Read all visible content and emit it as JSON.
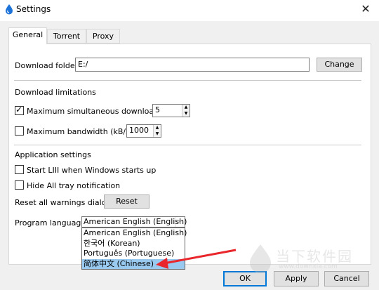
{
  "window": {
    "title": "Settings",
    "close_glyph": "✕",
    "icon": "app-drop-icon"
  },
  "tabs": [
    {
      "label": "General",
      "active": true
    },
    {
      "label": "Torrent",
      "active": false
    },
    {
      "label": "Proxy",
      "active": false
    }
  ],
  "general": {
    "download_folder_label": "Download folder:",
    "download_folder_value": "E:/",
    "change_button": "Change",
    "download_limitations_heading": "Download limitations",
    "max_downloads": {
      "label": "Maximum simultaneous downloads",
      "checked": true,
      "value": "5"
    },
    "max_bandwidth": {
      "label": "Maximum bandwidth (kB/s)",
      "checked": false,
      "value": "1000"
    },
    "app_settings_heading": "Application settings",
    "start_on_boot": {
      "label": "Start LIII when Windows starts up",
      "checked": false
    },
    "hide_tray": {
      "label": "Hide All tray notification",
      "checked": false
    },
    "reset_warnings_label": "Reset all warnings dialogs",
    "reset_button": "Reset",
    "program_language_label": "Program language",
    "language_selected": "American English (English)",
    "language_options": [
      "American English (English)",
      "한국어 (Korean)",
      "Português (Portuguese)",
      "简体中文 (Chinese)"
    ],
    "highlighted_option_index": 3
  },
  "buttons": {
    "ok": "OK",
    "apply": "Apply",
    "cancel": "Cancel"
  },
  "watermark": {
    "name": "当下软件园",
    "url": "www.downxia.com"
  },
  "colors": {
    "selection": "#99c9ef",
    "arrow": "#e8262b",
    "focus": "#0078d7"
  }
}
